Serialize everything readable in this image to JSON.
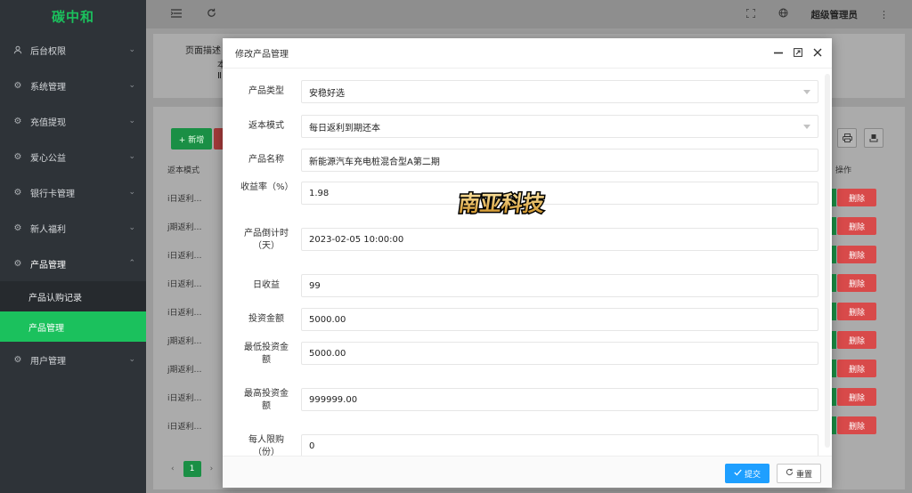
{
  "sidebar": {
    "brand": "碳中和",
    "items": [
      {
        "label": "后台权限",
        "icon": "user-icon"
      },
      {
        "label": "系统管理",
        "icon": "gear-icon"
      },
      {
        "label": "充值提现",
        "icon": "gear-icon"
      },
      {
        "label": "爱心公益",
        "icon": "gear-icon"
      },
      {
        "label": "银行卡管理",
        "icon": "gear-icon"
      },
      {
        "label": "新人福利",
        "icon": "gear-icon"
      },
      {
        "label": "产品管理",
        "icon": "gear-icon"
      },
      {
        "label": "用户管理",
        "icon": "gear-icon"
      }
    ],
    "subitems": [
      {
        "label": "产品认购记录"
      },
      {
        "label": "产品管理"
      }
    ]
  },
  "topbar": {
    "admin": "超级管理员"
  },
  "background": {
    "desc_label": "页面描述",
    "desc_frag1": "本",
    "desc_frag2": "Ⅱ",
    "add_label": "+ 新增",
    "col_mode": "返本模式",
    "op_label": "操作",
    "rows": [
      "i日返利…",
      "j期返利…",
      "i日返利…",
      "i日返利…",
      "i日返利…",
      "j期返利…",
      "j期返利…",
      "i日返利…",
      "i日返利…"
    ],
    "delete_label": "删除",
    "page_number": "1"
  },
  "modal": {
    "title": "修改产品管理",
    "fields": [
      {
        "label": "产品类型",
        "value": "安稳好选",
        "type": "select"
      },
      {
        "label": "返本模式",
        "value": "每日返利到期还本",
        "type": "select"
      },
      {
        "label": "产品名称",
        "value": "新能源汽车充电桩混合型A第二期",
        "type": "text"
      },
      {
        "label": "收益率（%）",
        "value": "1.98",
        "type": "text"
      },
      {
        "label": "产品倒计时（天）",
        "value": "2023-02-05 10:00:00",
        "type": "text"
      },
      {
        "label": "日收益",
        "value": "99",
        "type": "text"
      },
      {
        "label": "投资金额",
        "value": "5000.00",
        "type": "text"
      },
      {
        "label": "最低投资金额",
        "value": "5000.00",
        "type": "text"
      },
      {
        "label": "最高投资金额",
        "value": "999999.00",
        "type": "text"
      },
      {
        "label": "每人限购（份）",
        "value": "0",
        "type": "text"
      }
    ],
    "submit": "提交",
    "reset": "重置"
  },
  "watermark": {
    "text": "南亚科技"
  }
}
